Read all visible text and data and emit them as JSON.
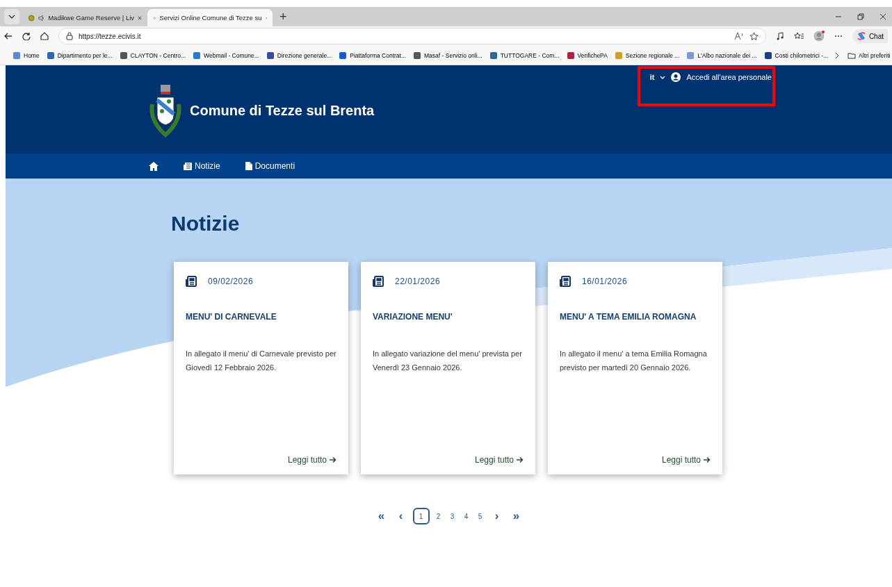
{
  "browser": {
    "tabs": [
      {
        "title": "Madikwe Game Reserve | Liv",
        "selected": false,
        "audio": true
      },
      {
        "title": "Servizi Online Comune di Tezze su",
        "selected": true,
        "audio": false
      }
    ],
    "new_tab": "+",
    "url": "https://tezze.ecivis.it",
    "copilot": "Chat",
    "bookmarks": [
      "Home",
      "Dipartimento per le...",
      "CLAYTON - Centro...",
      "Webmail - Comune...",
      "Direzione generale...",
      "Piattaforma Contrat...",
      "Masaf - Servizio onli...",
      "TUTTOGARE - Com...",
      "VerifichePA",
      "Sezione regionale ...",
      "L'Albo nazionale dei ...",
      "Costi chilometrici -..."
    ],
    "other_favorites": "Altri preferiti"
  },
  "site": {
    "language": "it",
    "login": "Accedi all'area personale",
    "title": "Comune di Tezze sul Brenta",
    "nav": [
      {
        "label": "Notizie"
      },
      {
        "label": "Documenti"
      }
    ]
  },
  "page_title": "Notizie",
  "cards": [
    {
      "date": "09/02/2026",
      "title": "MENU' DI CARNEVALE",
      "text": "In allegato il menu' di Carnevale previsto per Giovedì 12 Febbraio 2026.",
      "link": "Leggi tutto"
    },
    {
      "date": "22/01/2026",
      "title": "VARIAZIONE MENU'",
      "text": "In allegato variazione del menu' prevista per Venerdì 23 Gennaio 2026.",
      "link": "Leggi tutto"
    },
    {
      "date": "16/01/2026",
      "title": "MENU' A TEMA EMILIA ROMAGNA",
      "text": "In allegato il menu' a tema Emilia Romagna previsto per martedì 20 Gennaio 2026.",
      "link": "Leggi tutto"
    }
  ],
  "pagination": {
    "first": "«",
    "prev": "‹",
    "next": "›",
    "last": "»",
    "pages": [
      {
        "label": "1",
        "selected": true
      },
      {
        "label": "2",
        "selected": false
      },
      {
        "label": "3",
        "selected": false
      },
      {
        "label": "4",
        "selected": false
      },
      {
        "label": "5",
        "selected": false
      }
    ]
  }
}
